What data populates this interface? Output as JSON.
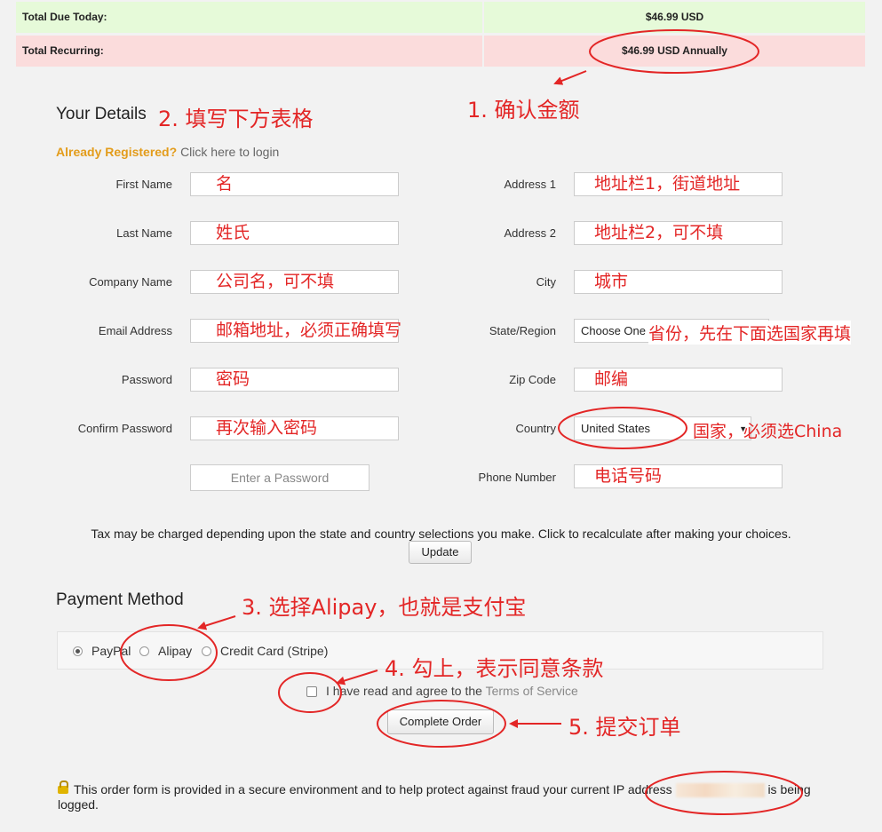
{
  "totals": {
    "due_label": "Total Due Today:",
    "due_value": "$46.99 USD",
    "recurring_label": "Total Recurring:",
    "recurring_value": "$46.99 USD Annually"
  },
  "your_details": {
    "heading": "Your Details",
    "already_registered": "Already Registered?",
    "login_link": "Click here to login"
  },
  "form": {
    "first_name_label": "First Name",
    "first_name_value": "名",
    "last_name_label": "Last Name",
    "last_name_value": "姓氏",
    "company_label": "Company Name",
    "company_value": "公司名，可不填",
    "email_label": "Email Address",
    "email_value": "邮箱地址，必须正确填写",
    "password_label": "Password",
    "password_value": "密码",
    "confirm_label": "Confirm Password",
    "confirm_value": "再次输入密码",
    "password_hint": "Enter a Password",
    "address1_label": "Address 1",
    "address1_value": "地址栏1，街道地址",
    "address2_label": "Address 2",
    "address2_value": "地址栏2，可不填",
    "city_label": "City",
    "city_value": "城市",
    "state_label": "State/Region",
    "state_value": "Choose One",
    "zip_label": "Zip Code",
    "zip_value": "邮编",
    "country_label": "Country",
    "country_value": "United States",
    "phone_label": "Phone Number",
    "phone_value": "电话号码"
  },
  "tax": {
    "note": "Tax may be charged depending upon the state and country selections you make. Click to recalculate after making your choices.",
    "update_button": "Update"
  },
  "payment": {
    "heading": "Payment Method",
    "options": [
      "PayPal",
      "Alipay",
      "Credit Card (Stripe)"
    ],
    "selected": "PayPal",
    "tos_prefix": "I have read and agree to the",
    "tos_link": "Terms of Service",
    "complete_button": "Complete Order"
  },
  "footer": {
    "text_before": "This order form is provided in a secure environment and to help protect against fraud your current IP address",
    "text_after": "is being logged."
  },
  "annotations": {
    "step1": "1. 确认金额",
    "step2": "2. 填写下方表格",
    "step3": "3. 选择Alipay，也就是支付宝",
    "step4": "4. 勾上，表示同意条款",
    "step5": "5. 提交订单",
    "state_note": "省份，先在下面选国家再填",
    "country_note": "国家，必须选China"
  },
  "colors": {
    "annotation_red": "#e32626",
    "due_bg": "#e6fad9",
    "recurring_bg": "#fbdcdc",
    "registered_orange": "#e39c1b"
  }
}
